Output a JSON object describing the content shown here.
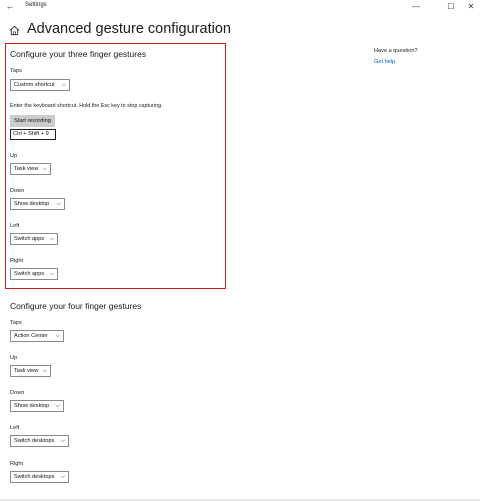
{
  "window": {
    "app_title": "Settings",
    "back_glyph": "←",
    "minimize_glyph": "—",
    "maximize_glyph": "☐",
    "close_glyph": "✕"
  },
  "header": {
    "title": "Advanced gesture configuration"
  },
  "three_finger": {
    "title": "Configure your three finger gestures",
    "taps_label": "Taps",
    "taps_value": "Custom shortcut",
    "instructions": "Enter the keyboard shortcut. Hold the Esc key to stop capturing.",
    "record_button": "Start recording",
    "shortcut_value": "Ctrl + Shift + 9",
    "up_label": "Up",
    "up_value": "Task view",
    "down_label": "Down",
    "down_value": "Show desktop",
    "left_label": "Left",
    "left_value": "Switch apps",
    "right_label": "Right",
    "right_value": "Switch apps"
  },
  "four_finger": {
    "title": "Configure your four finger gestures",
    "taps_label": "Taps",
    "taps_value": "Action Center",
    "up_label": "Up",
    "up_value": "Task view",
    "down_label": "Down",
    "down_value": "Show desktop",
    "left_label": "Left",
    "left_value": "Switch desktops",
    "right_label": "Right",
    "right_value": "Switch desktops"
  },
  "help": {
    "title": "Have a question?",
    "link": "Get help"
  },
  "colors": {
    "highlight": "#d11a1a",
    "link": "#0063b1",
    "button_bg": "#cccccc"
  },
  "icons": {
    "home": "home-icon",
    "chevron": "chevron-down-icon"
  }
}
